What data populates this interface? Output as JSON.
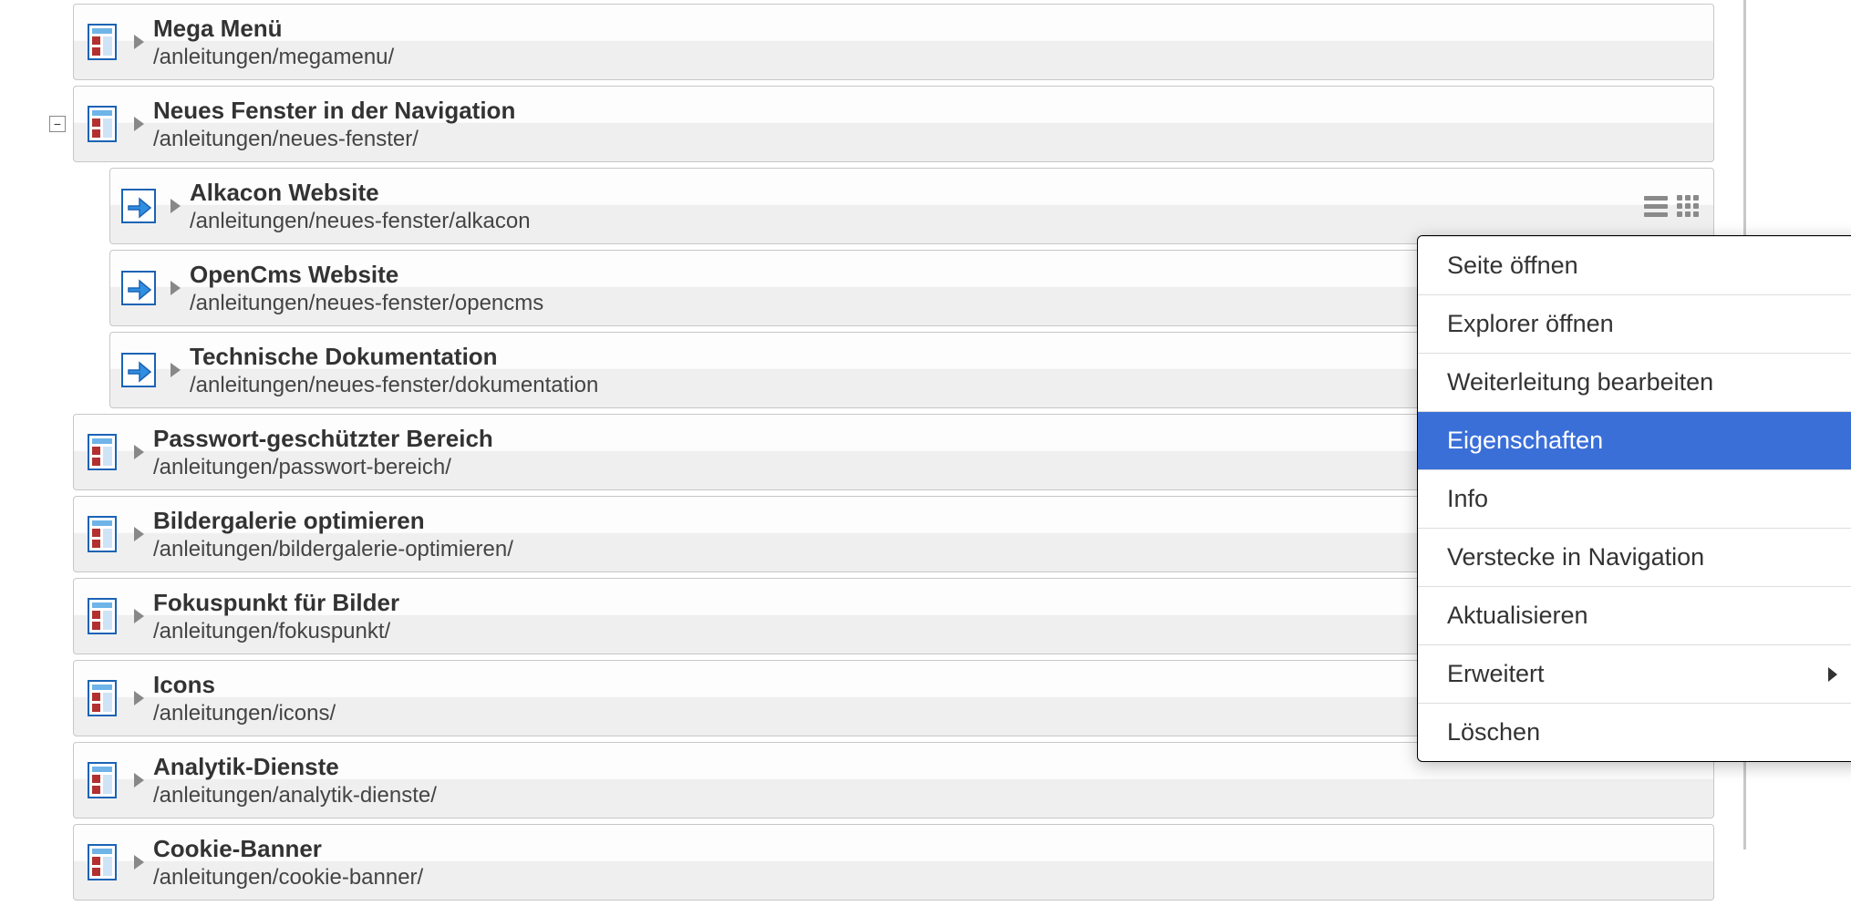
{
  "tree": [
    {
      "indent": 80,
      "icon": "page",
      "title": "Mega Menü",
      "path": "/anleitungen/megamenu/",
      "toggle": null,
      "actions": false
    },
    {
      "indent": 80,
      "icon": "page",
      "title": "Neues Fenster in der Navigation",
      "path": "/anleitungen/neues-fenster/",
      "toggle": "minus",
      "actions": false
    },
    {
      "indent": 120,
      "icon": "redirect",
      "title": "Alkacon Website",
      "path": "/anleitungen/neues-fenster/alkacon",
      "toggle": null,
      "actions": true
    },
    {
      "indent": 120,
      "icon": "redirect",
      "title": "OpenCms Website",
      "path": "/anleitungen/neues-fenster/opencms",
      "toggle": null,
      "actions": false
    },
    {
      "indent": 120,
      "icon": "redirect",
      "title": "Technische Dokumentation",
      "path": "/anleitungen/neues-fenster/dokumentation",
      "toggle": null,
      "actions": false
    },
    {
      "indent": 80,
      "icon": "page",
      "title": "Passwort-geschützter Bereich",
      "path": "/anleitungen/passwort-bereich/",
      "toggle": null,
      "actions": false
    },
    {
      "indent": 80,
      "icon": "page",
      "title": "Bildergalerie optimieren",
      "path": "/anleitungen/bildergalerie-optimieren/",
      "toggle": null,
      "actions": false
    },
    {
      "indent": 80,
      "icon": "page",
      "title": "Fokuspunkt für Bilder",
      "path": "/anleitungen/fokuspunkt/",
      "toggle": null,
      "actions": false
    },
    {
      "indent": 80,
      "icon": "page",
      "title": "Icons",
      "path": "/anleitungen/icons/",
      "toggle": null,
      "actions": false
    },
    {
      "indent": 80,
      "icon": "page",
      "title": "Analytik-Dienste",
      "path": "/anleitungen/analytik-dienste/",
      "toggle": null,
      "actions": false
    },
    {
      "indent": 80,
      "icon": "page",
      "title": "Cookie-Banner",
      "path": "/anleitungen/cookie-banner/",
      "toggle": null,
      "actions": false
    }
  ],
  "context_menu": [
    {
      "label": "Seite öffnen",
      "active": false,
      "submenu": false
    },
    {
      "label": "Explorer öffnen",
      "active": false,
      "submenu": false
    },
    {
      "label": "Weiterleitung bearbeiten",
      "active": false,
      "submenu": false
    },
    {
      "label": "Eigenschaften",
      "active": true,
      "submenu": false
    },
    {
      "label": "Info",
      "active": false,
      "submenu": false
    },
    {
      "label": "Verstecke in Navigation",
      "active": false,
      "submenu": false
    },
    {
      "label": "Aktualisieren",
      "active": false,
      "submenu": false
    },
    {
      "label": "Erweitert",
      "active": false,
      "submenu": true
    },
    {
      "label": "Löschen",
      "active": false,
      "submenu": false
    }
  ],
  "toggle_minus_label": "−"
}
